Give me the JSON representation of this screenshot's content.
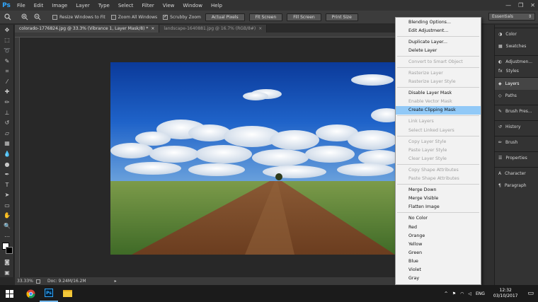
{
  "app": {
    "logo": "Ps"
  },
  "menubar": {
    "items": [
      "File",
      "Edit",
      "Image",
      "Layer",
      "Type",
      "Select",
      "Filter",
      "View",
      "Window",
      "Help"
    ],
    "window_controls": [
      "—",
      "❐",
      "✕"
    ]
  },
  "options": {
    "resize_windows": "Resize Windows to Fit",
    "zoom_all": "Zoom All Windows",
    "scrubby_zoom": "Scrubby Zoom",
    "actual_pixels": "Actual Pixels",
    "fit_screen": "Fit Screen",
    "fill_screen": "Fill Screen",
    "print_size": "Print Size",
    "workspace": "Essentials"
  },
  "tabs": [
    {
      "label": "colorado-1776824.jpg @ 33.3% (Vibrance 1, Layer Mask/8) *",
      "close": "×"
    },
    {
      "label": "landscape-1640881.jpg @ 16.7% (RGB/8#)",
      "close": "×"
    }
  ],
  "status": {
    "zoom": "33.33%",
    "doc": "Doc: 9.24M/16.2M"
  },
  "panels": {
    "group1": [
      "Color",
      "Swatches"
    ],
    "group2": [
      "Adjustmen...",
      "Styles"
    ],
    "group3": [
      "Layers",
      "Paths"
    ],
    "group4": [
      "Brush Pres..."
    ],
    "group5": [
      "History"
    ],
    "group6": [
      "Brush"
    ],
    "group7": [
      "Properties"
    ],
    "group8": [
      "Character",
      "Paragraph"
    ]
  },
  "context_menu": [
    {
      "label": "Blending Options...",
      "state": "enabled"
    },
    {
      "label": "Edit Adjustment...",
      "state": "enabled"
    },
    {
      "sep": true
    },
    {
      "label": "Duplicate Layer...",
      "state": "enabled"
    },
    {
      "label": "Delete Layer",
      "state": "enabled"
    },
    {
      "sep": true
    },
    {
      "label": "Convert to Smart Object",
      "state": "disabled"
    },
    {
      "sep": true
    },
    {
      "label": "Rasterize Layer",
      "state": "disabled"
    },
    {
      "label": "Rasterize Layer Style",
      "state": "disabled"
    },
    {
      "sep": true
    },
    {
      "label": "Disable Layer Mask",
      "state": "enabled"
    },
    {
      "label": "Enable Vector Mask",
      "state": "disabled"
    },
    {
      "label": "Create Clipping Mask",
      "state": "hover"
    },
    {
      "sep": true
    },
    {
      "label": "Link Layers",
      "state": "disabled"
    },
    {
      "label": "Select Linked Layers",
      "state": "disabled"
    },
    {
      "sep": true
    },
    {
      "label": "Copy Layer Style",
      "state": "disabled"
    },
    {
      "label": "Paste Layer Style",
      "state": "disabled"
    },
    {
      "label": "Clear Layer Style",
      "state": "disabled"
    },
    {
      "sep": true
    },
    {
      "label": "Copy Shape Attributes",
      "state": "disabled"
    },
    {
      "label": "Paste Shape Attributes",
      "state": "disabled"
    },
    {
      "sep": true
    },
    {
      "label": "Merge Down",
      "state": "enabled"
    },
    {
      "label": "Merge Visible",
      "state": "enabled"
    },
    {
      "label": "Flatten Image",
      "state": "enabled"
    },
    {
      "sep": true
    },
    {
      "label": "No Color",
      "state": "enabled"
    },
    {
      "label": "Red",
      "state": "enabled"
    },
    {
      "label": "Orange",
      "state": "enabled"
    },
    {
      "label": "Yellow",
      "state": "enabled"
    },
    {
      "label": "Green",
      "state": "enabled"
    },
    {
      "label": "Blue",
      "state": "enabled"
    },
    {
      "label": "Violet",
      "state": "enabled"
    },
    {
      "label": "Gray",
      "state": "enabled"
    }
  ],
  "taskbar": {
    "lang": "ENG",
    "time": "12:32",
    "date": "03/10/2017"
  },
  "colors": {
    "accent": "#31a8ff",
    "menu_hover": "#91c9f7"
  }
}
